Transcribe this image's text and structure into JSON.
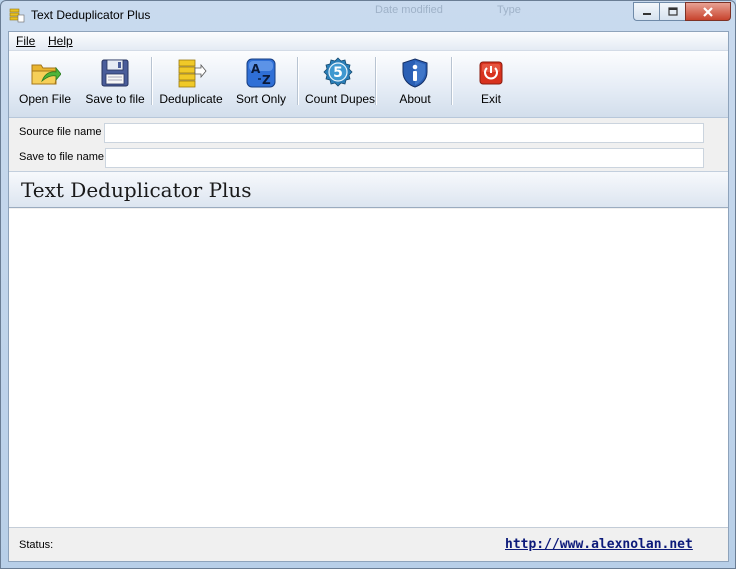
{
  "window": {
    "title": "Text Deduplicator Plus",
    "background_labels": [
      "Date modified",
      "Type"
    ]
  },
  "menu": {
    "file_label": "File",
    "help_label": "Help"
  },
  "toolbar": {
    "open_file": "Open File",
    "save_to_file": "Save to file",
    "deduplicate": "Deduplicate",
    "sort_only": "Sort Only",
    "count_dupes": "Count Dupes",
    "about": "About",
    "exit": "Exit"
  },
  "fields": {
    "source_label": "Source file name",
    "source_value": "",
    "save_label": "Save to file name",
    "save_value": ""
  },
  "banner": {
    "title": "Text Deduplicator Plus"
  },
  "status": {
    "label": "Status:",
    "link": "http://www.alexnolan.net"
  },
  "colors": {
    "accent_link": "#0c1a7a",
    "close_button": "#c7432d",
    "window_frame": "#b9d1ea"
  },
  "icons": {
    "open_file": "folder-open-arrow-icon",
    "save_to_file": "floppy-disk-icon",
    "deduplicate": "stacked-files-icon",
    "sort_only": "sort-az-icon",
    "count_dupes": "count-badge-icon",
    "about": "info-shield-icon",
    "exit": "power-icon"
  },
  "count_badge_number": "5",
  "sort_glyphs": [
    "A",
    "Z"
  ]
}
